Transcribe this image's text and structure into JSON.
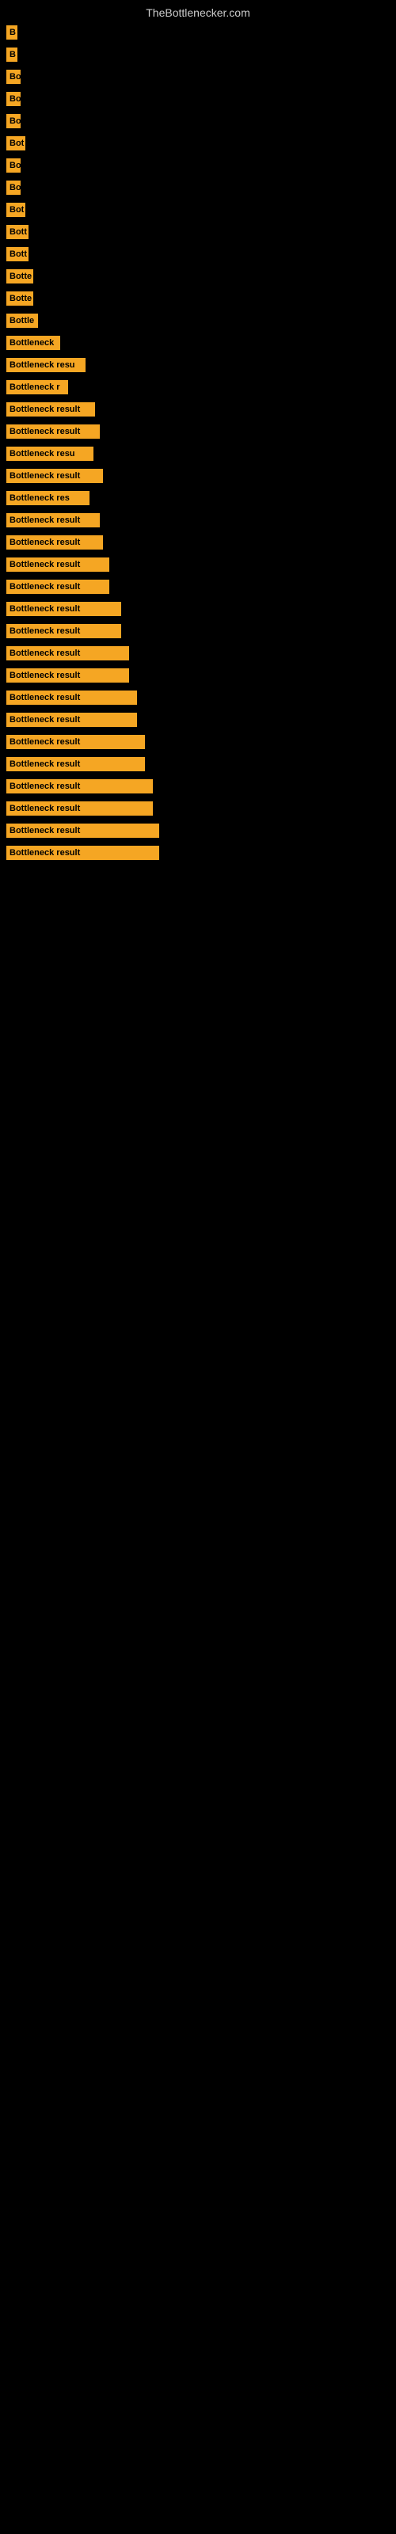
{
  "header": {
    "title": "TheBottlenecker.com"
  },
  "rows": [
    {
      "label": "B",
      "width": 14
    },
    {
      "label": "B",
      "width": 14
    },
    {
      "label": "Bo",
      "width": 18
    },
    {
      "label": "Bo",
      "width": 18
    },
    {
      "label": "Bo",
      "width": 18
    },
    {
      "label": "Bot",
      "width": 24
    },
    {
      "label": "Bo",
      "width": 18
    },
    {
      "label": "Bo",
      "width": 18
    },
    {
      "label": "Bot",
      "width": 24
    },
    {
      "label": "Bott",
      "width": 28
    },
    {
      "label": "Bott",
      "width": 28
    },
    {
      "label": "Botte",
      "width": 34
    },
    {
      "label": "Botte",
      "width": 34
    },
    {
      "label": "Bottle",
      "width": 40
    },
    {
      "label": "Bottleneck",
      "width": 68
    },
    {
      "label": "Bottleneck resu",
      "width": 100
    },
    {
      "label": "Bottleneck r",
      "width": 78
    },
    {
      "label": "Bottleneck result",
      "width": 112
    },
    {
      "label": "Bottleneck result",
      "width": 118
    },
    {
      "label": "Bottleneck resu",
      "width": 110
    },
    {
      "label": "Bottleneck result",
      "width": 122
    },
    {
      "label": "Bottleneck res",
      "width": 105
    },
    {
      "label": "Bottleneck result",
      "width": 118
    },
    {
      "label": "Bottleneck result",
      "width": 122
    },
    {
      "label": "Bottleneck result",
      "width": 130
    },
    {
      "label": "Bottleneck result",
      "width": 130
    },
    {
      "label": "Bottleneck result",
      "width": 145
    },
    {
      "label": "Bottleneck result",
      "width": 145
    },
    {
      "label": "Bottleneck result",
      "width": 155
    },
    {
      "label": "Bottleneck result",
      "width": 155
    },
    {
      "label": "Bottleneck result",
      "width": 165
    },
    {
      "label": "Bottleneck result",
      "width": 165
    },
    {
      "label": "Bottleneck result",
      "width": 175
    },
    {
      "label": "Bottleneck result",
      "width": 175
    },
    {
      "label": "Bottleneck result",
      "width": 185
    },
    {
      "label": "Bottleneck result",
      "width": 185
    },
    {
      "label": "Bottleneck result",
      "width": 193
    },
    {
      "label": "Bottleneck result",
      "width": 193
    }
  ]
}
